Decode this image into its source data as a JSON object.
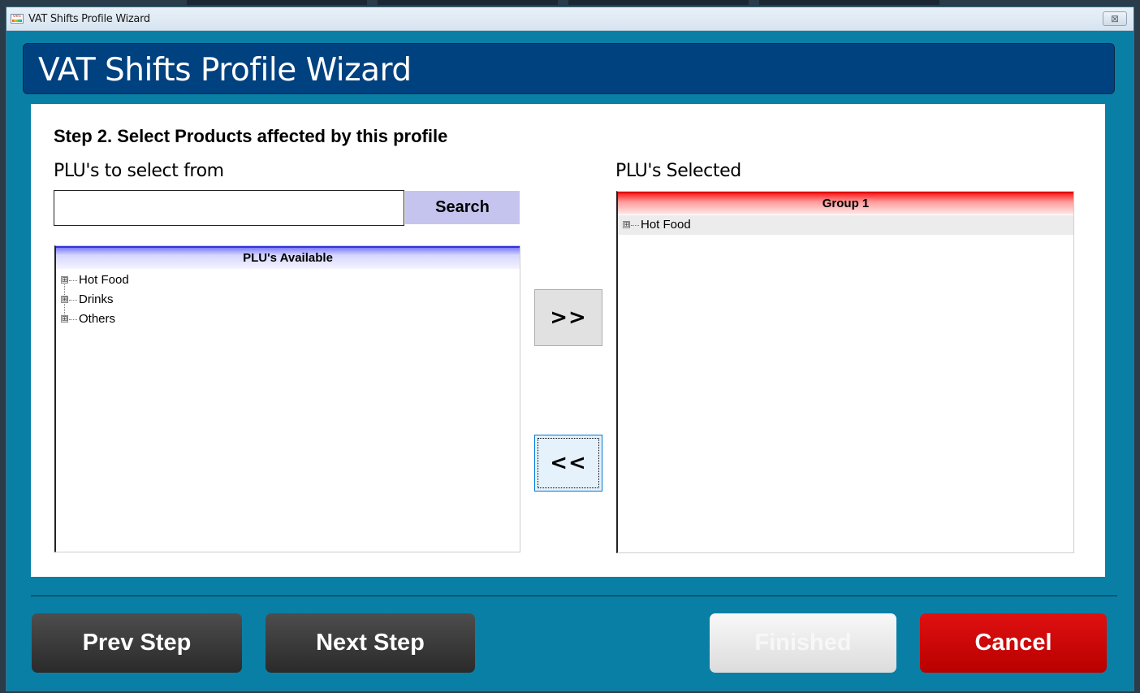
{
  "window": {
    "title": "VAT Shifts Profile Wizard",
    "close_glyph": "⊠"
  },
  "header": {
    "title": "VAT Shifts Profile Wizard"
  },
  "step": {
    "title": "Step 2.  Select Products affected by this profile"
  },
  "available": {
    "label": "PLU's to select from",
    "search_value": "",
    "search_button": "Search",
    "list_header": "PLU's Available",
    "items": [
      {
        "label": "Hot Food"
      },
      {
        "label": "Drinks"
      },
      {
        "label": "Others"
      }
    ]
  },
  "selected": {
    "label": "PLU's Selected",
    "group_header": "Group 1",
    "items": [
      {
        "label": "Hot Food"
      }
    ]
  },
  "transfer": {
    "add_label": ">>",
    "remove_label": "<<"
  },
  "footer": {
    "prev": "Prev Step",
    "next": "Next Step",
    "finished": "Finished",
    "cancel": "Cancel"
  },
  "icons": {
    "app": "oes-app-icon",
    "expander": "⊞"
  },
  "colors": {
    "window_bg": "#0a7fa6",
    "header_bg": "#00417f",
    "available_header": "#7d7dff",
    "selected_header": "#ff2020",
    "cancel": "#d00000"
  }
}
